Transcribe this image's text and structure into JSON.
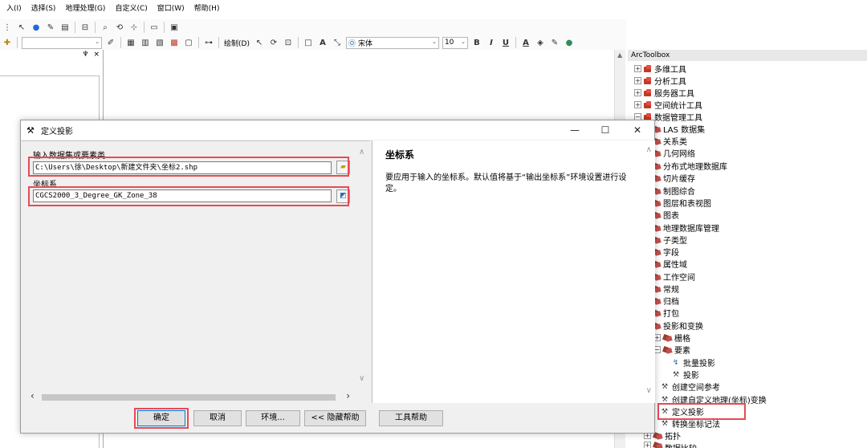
{
  "menubar": [
    "入(I)",
    "选择(S)",
    "地理处理(G)",
    "自定义(C)",
    "窗口(W)",
    "帮助(H)"
  ],
  "toolbar2": {
    "draw_label": "绘制(D)",
    "font_name": "宋体",
    "font_size": "10",
    "bold": "B",
    "italic": "I",
    "underline": "U",
    "text_tool": "A"
  },
  "leftpanel": {
    "pin": "♆",
    "close": "×"
  },
  "arctoolbox": {
    "title": "ArcToolbox",
    "items": [
      "多维工具",
      "分析工具",
      "服务器工具",
      "空间统计工具",
      "数据管理工具",
      "LAS 数据集",
      "关系类",
      "几何网络",
      "分布式地理数据库",
      "切片缓存",
      "制图综合",
      "图层和表视图",
      "图表",
      "地理数据库管理",
      "子类型",
      "字段",
      "属性域",
      "工作空间",
      "常规",
      "归档",
      "打包",
      "投影和变换",
      "栅格",
      "要素",
      "批量投影",
      "投影",
      "创建空间参考",
      "创建自定义地理(坐标)变换",
      "定义投影",
      "转换坐标记法",
      "拓扑",
      "数据比较"
    ]
  },
  "dialog": {
    "title": "定义投影",
    "input_label": "输入数据集或要素类",
    "input_value": "C:\\Users\\徐\\Desktop\\新建文件夹\\坐标2.shp",
    "cs_label": "坐标系",
    "cs_value": "CGCS2000_3_Degree_GK_Zone_38",
    "help_title": "坐标系",
    "help_body": "要应用于输入的坐标系。默认值将基于“输出坐标系”环境设置进行设定。",
    "buttons": {
      "ok": "确定",
      "cancel": "取消",
      "env": "环境...",
      "hide_help": "<< 隐藏帮助",
      "tool_help": "工具帮助"
    }
  },
  "colors": {
    "highlight": "#e84a55",
    "toolbox_red": "#c0392b"
  }
}
